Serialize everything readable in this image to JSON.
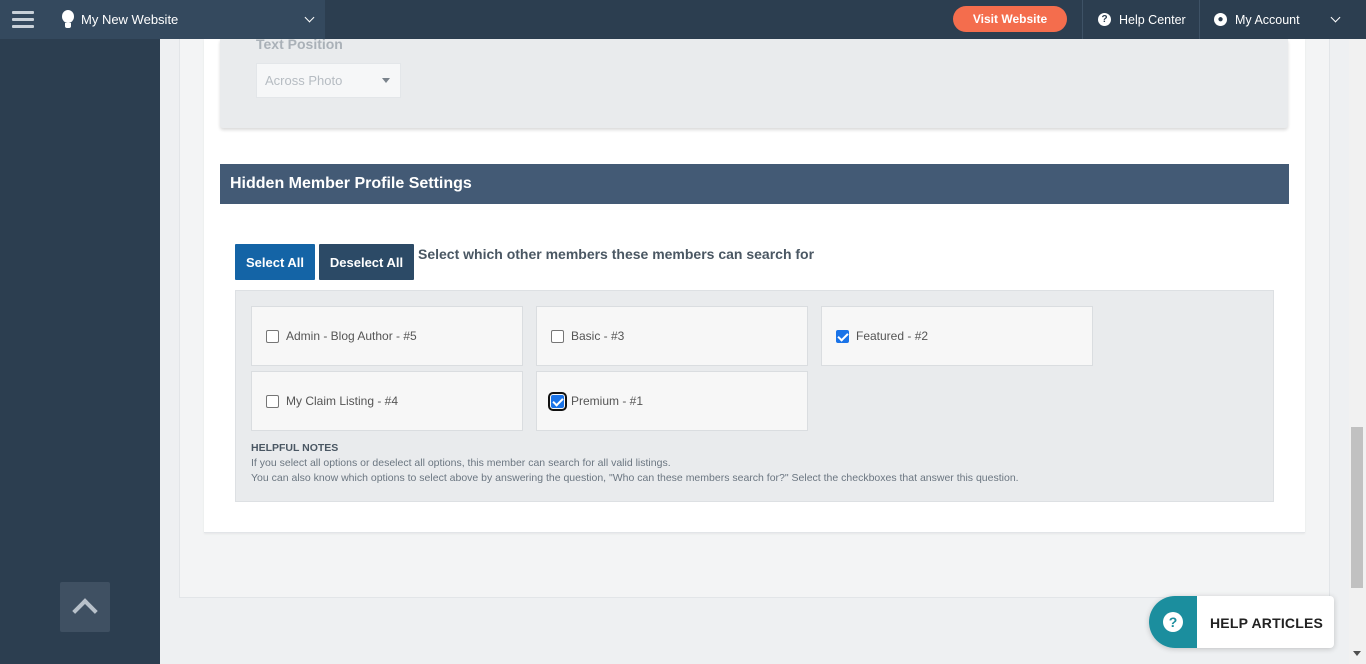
{
  "topbar": {
    "site_name": "My New Website",
    "visit_button": "Visit Website",
    "help_center": "Help Center",
    "my_account": "My Account"
  },
  "previous_section": {
    "text_position_label": "Text Position",
    "text_position_value": "Across Photo"
  },
  "hidden_member": {
    "header": "Hidden Member Profile Settings",
    "select_all": "Select All",
    "deselect_all": "Deselect All",
    "hint": "Select which other members these members can search for",
    "options": [
      {
        "label": "Admin - Blog Author - #5",
        "checked": false
      },
      {
        "label": "Basic - #3",
        "checked": false
      },
      {
        "label": "Featured - #2",
        "checked": true
      },
      {
        "label": "My Claim Listing - #4",
        "checked": false
      },
      {
        "label": "Premium - #1",
        "checked": true
      }
    ],
    "notes_title": "HELPFUL NOTES",
    "notes": [
      "If you select all options or deselect all options, this member can search for all valid listings.",
      "You can also know which options to select above by answering the question, \"Who can these members search for?\" Select the checkboxes that answer this question."
    ]
  },
  "help_widget": {
    "label": "HELP ARTICLES"
  },
  "colors": {
    "topbar": "#2c3e50",
    "visit_button": "#f46d4d",
    "section_header": "#435a75",
    "select_all": "#1464a6",
    "deselect_all": "#2c4a66",
    "help_widget_icon": "#1b8e9e"
  },
  "icons": [
    "hamburger-icon",
    "lightbulb-icon",
    "chevron-down-icon",
    "question-circle-icon",
    "user-circle-icon",
    "chevron-up-icon",
    "caret-down-icon"
  ]
}
